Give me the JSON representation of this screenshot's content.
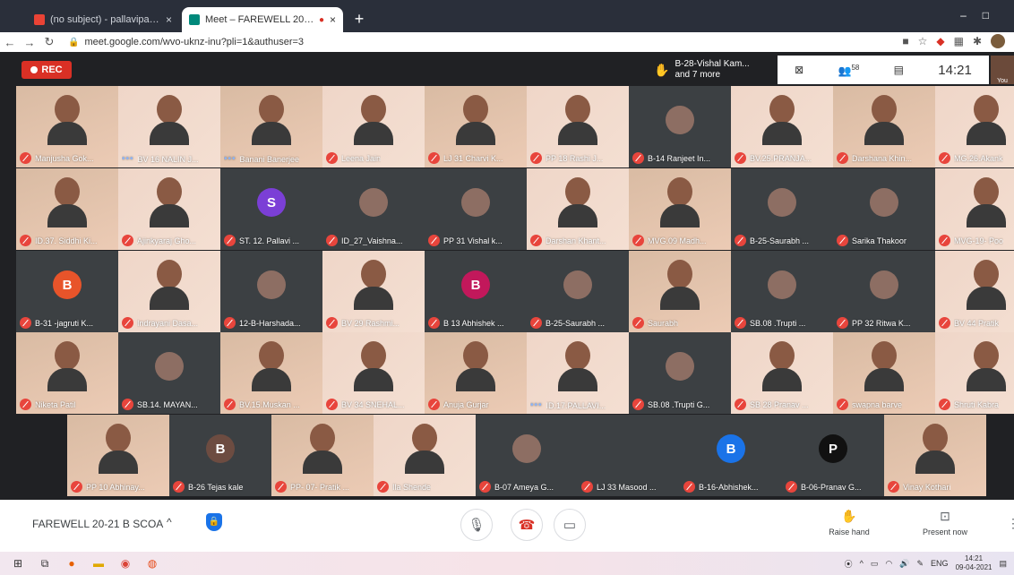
{
  "browser": {
    "tabs": [
      {
        "title": "(no subject) - pallavipatil.scoa@...",
        "active": false
      },
      {
        "title": "Meet – FAREWELL 20-21 B S...",
        "active": true
      }
    ],
    "new_tab": "+",
    "url": "meet.google.com/wvo-uknz-inu?pli=1&authuser=3"
  },
  "meet": {
    "rec_label": "REC",
    "presenter": {
      "line1": "B-28-Vishal Kam...",
      "line2": "and 7 more"
    },
    "participants_count": "58",
    "clock": "14:21",
    "self_label": "You"
  },
  "participants": [
    {
      "name": "Manjusha Gok...",
      "style": "cam",
      "muted": true
    },
    {
      "name": "BV 16 NALIN J...",
      "style": "cam",
      "muted": false,
      "speaking": true
    },
    {
      "name": "Banani Banerjee",
      "style": "cam",
      "muted": false,
      "speaking": true
    },
    {
      "name": "Leena Jain",
      "style": "cam",
      "muted": true
    },
    {
      "name": "LJ 31 Charvi K...",
      "style": "cam",
      "muted": true
    },
    {
      "name": "PP 18 Rashi J...",
      "style": "cam",
      "muted": true
    },
    {
      "name": "B-14 Ranjeet In...",
      "style": "dark",
      "muted": true,
      "avatar_img": true
    },
    {
      "name": "BV.25.PRANJA...",
      "style": "cam",
      "muted": true
    },
    {
      "name": "Darshana Khin...",
      "style": "cam",
      "muted": true
    },
    {
      "name": "MG.26.Akank",
      "style": "cam",
      "muted": true
    },
    {
      "name": "ID.37. Siddhi Ki...",
      "style": "cam",
      "muted": true
    },
    {
      "name": "Ajinkyaraj Gho...",
      "style": "cam",
      "muted": true
    },
    {
      "name": "ST. 12. Pallavi ...",
      "style": "dark",
      "muted": true,
      "avatar_letter": "S",
      "avatar_color": "#7b3fd6"
    },
    {
      "name": "ID_27_Vaishna...",
      "style": "dark",
      "muted": true,
      "avatar_img": true
    },
    {
      "name": "PP 31 Vishal k...",
      "style": "dark",
      "muted": true,
      "avatar_img": true
    },
    {
      "name": "Darshan Khant...",
      "style": "cam",
      "muted": true
    },
    {
      "name": "MVG.09 Madh...",
      "style": "cam",
      "muted": true
    },
    {
      "name": "B-25-Saurabh ...",
      "style": "dark",
      "muted": true,
      "avatar_img": true
    },
    {
      "name": "Sarika Thakoor",
      "style": "dark",
      "muted": true,
      "avatar_img": true
    },
    {
      "name": "MVG-19- Poo",
      "style": "cam",
      "muted": true
    },
    {
      "name": "B-31 -jagruti K...",
      "style": "dark",
      "muted": true,
      "avatar_letter": "B",
      "avatar_color": "#e8542a"
    },
    {
      "name": "Indrayani Dasa...",
      "style": "cam",
      "muted": true
    },
    {
      "name": "12-B-Harshada...",
      "style": "dark",
      "muted": true,
      "avatar_img": true
    },
    {
      "name": "BV 29 Rashmi...",
      "style": "cam",
      "muted": true
    },
    {
      "name": "B 13 Abhishek ...",
      "style": "dark",
      "muted": true,
      "avatar_letter": "B",
      "avatar_color": "#c2185b"
    },
    {
      "name": "B-25-Saurabh ...",
      "style": "dark",
      "muted": true,
      "avatar_img": true
    },
    {
      "name": "Saurabh",
      "style": "cam",
      "muted": true
    },
    {
      "name": "SB.08 .Trupti ...",
      "style": "dark",
      "muted": true,
      "avatar_img": true
    },
    {
      "name": "PP 32 Ritwa K...",
      "style": "dark",
      "muted": true,
      "avatar_img": true
    },
    {
      "name": "BV 44 Pratik",
      "style": "cam",
      "muted": true
    },
    {
      "name": "Niketa Patil",
      "style": "cam",
      "muted": true
    },
    {
      "name": "SB.14. MAYAN...",
      "style": "dark",
      "muted": true,
      "avatar_img": true
    },
    {
      "name": "BV.15.Muskan ...",
      "style": "cam",
      "muted": true
    },
    {
      "name": "BV 34 SNEHAL...",
      "style": "cam",
      "muted": true
    },
    {
      "name": "Anuja Gurjar",
      "style": "cam",
      "muted": true
    },
    {
      "name": "ID.17.PALLAVI...",
      "style": "cam",
      "muted": false,
      "speaking": true
    },
    {
      "name": "SB.08 .Trupti G...",
      "style": "dark",
      "muted": true,
      "avatar_img": true
    },
    {
      "name": "SB 28 Pranav ...",
      "style": "cam",
      "muted": true
    },
    {
      "name": "swapna barve",
      "style": "cam",
      "muted": true
    },
    {
      "name": "Shruti Kabra",
      "style": "cam",
      "muted": true
    },
    {
      "name": "PP 10 Abhinay...",
      "style": "cam",
      "muted": true
    },
    {
      "name": "B-26 Tejas kale",
      "style": "dark",
      "muted": true,
      "avatar_letter": "B",
      "avatar_color": "#6d4c41"
    },
    {
      "name": "PP- 07- Pratik ...",
      "style": "cam",
      "muted": true
    },
    {
      "name": "Ila Shende",
      "style": "cam",
      "muted": true
    },
    {
      "name": "B-07 Ameya G...",
      "style": "dark",
      "muted": true,
      "avatar_img": true
    },
    {
      "name": "LJ 33 Masood ...",
      "style": "dark",
      "muted": true
    },
    {
      "name": "B-16-Abhishek...",
      "style": "dark",
      "muted": true,
      "avatar_letter": "B",
      "avatar_color": "#1a73e8"
    },
    {
      "name": "B-06-Pranav G...",
      "style": "dark",
      "muted": true,
      "avatar_letter": "P",
      "avatar_color": "#111111"
    },
    {
      "name": "Vinay Kothari",
      "style": "cam",
      "muted": true
    }
  ],
  "bottom": {
    "meeting_title": "FAREWELL 20-21 B SCOA",
    "chevron": "^",
    "raise_hand": "Raise hand",
    "present_now": "Present now"
  },
  "taskbar": {
    "lang": "ENG",
    "time": "14:21",
    "date": "09-04-2021"
  }
}
